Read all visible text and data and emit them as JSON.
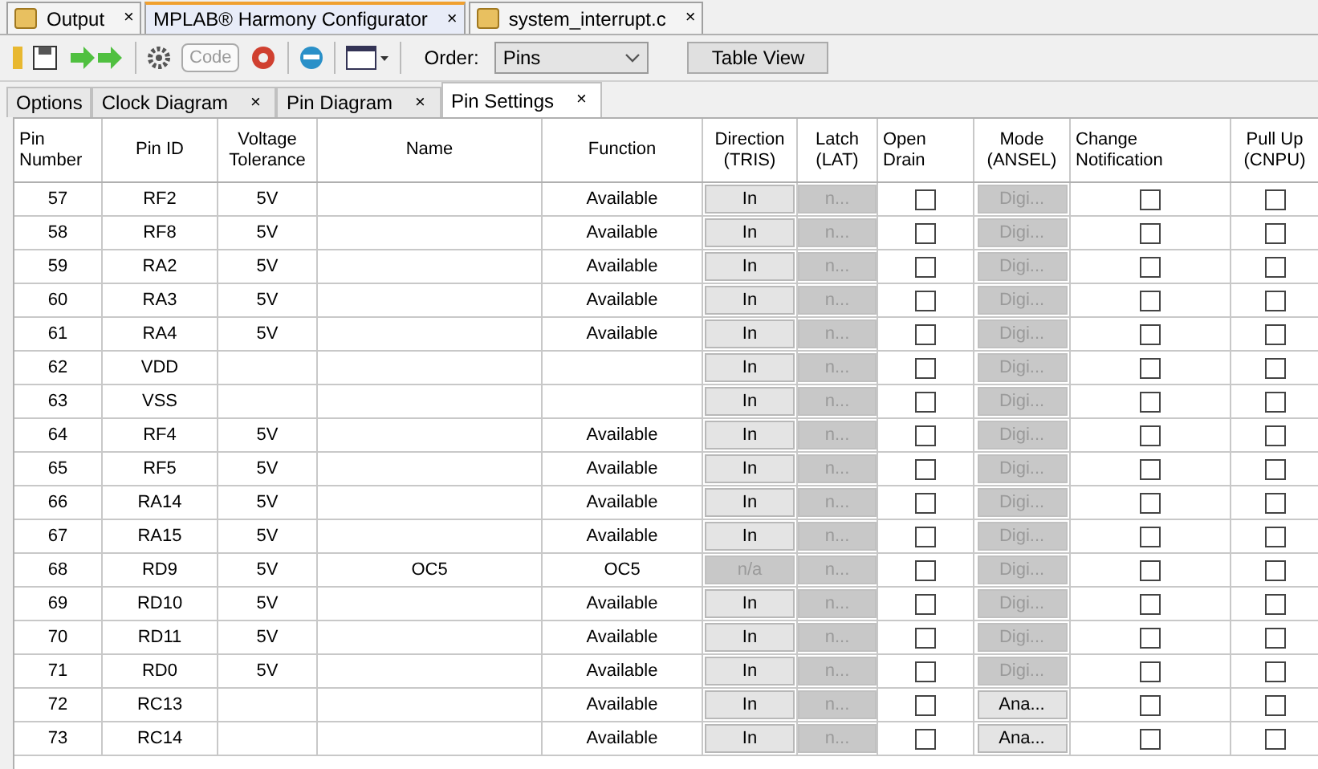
{
  "editor_tabs": [
    {
      "label": "Output",
      "close": "×",
      "selected": false
    },
    {
      "label": "MPLAB® Harmony Configurator",
      "close": "×",
      "selected": true
    },
    {
      "label": "system_interrupt.c",
      "close": "×",
      "selected": false
    }
  ],
  "toolbar": {
    "code_button": "Code",
    "order_label": "Order:",
    "order_value": "Pins",
    "table_view_button": "Table View"
  },
  "view_tabs": [
    {
      "label": "Options",
      "selected": false
    },
    {
      "label": "Clock Diagram",
      "close": "×",
      "selected": false
    },
    {
      "label": "Pin Diagram",
      "close": "×",
      "selected": false
    },
    {
      "label": "Pin Settings",
      "close": "×",
      "selected": true
    }
  ],
  "table": {
    "columns": [
      [
        "Pin",
        "Number"
      ],
      [
        "Pin ID"
      ],
      [
        "Voltage",
        "Tolerance"
      ],
      [
        "Name"
      ],
      [
        "Function"
      ],
      [
        "Direction",
        "(TRIS)"
      ],
      [
        "Latch",
        "(LAT)"
      ],
      [
        "Open",
        "Drain"
      ],
      [
        "Mode",
        "(ANSEL)"
      ],
      [
        "Change",
        "Notification"
      ],
      [
        "Pull Up",
        "(CNPU)"
      ]
    ],
    "rows": [
      {
        "pin": "57",
        "id": "RF2",
        "volt": "5V",
        "name": "",
        "func": "Available",
        "dir": "In",
        "dir_disabled": false,
        "lat": "n...",
        "od": false,
        "mode": "Digi...",
        "mode_disabled": true,
        "cn": false,
        "pu": false
      },
      {
        "pin": "58",
        "id": "RF8",
        "volt": "5V",
        "name": "",
        "func": "Available",
        "dir": "In",
        "dir_disabled": false,
        "lat": "n...",
        "od": false,
        "mode": "Digi...",
        "mode_disabled": true,
        "cn": false,
        "pu": false
      },
      {
        "pin": "59",
        "id": "RA2",
        "volt": "5V",
        "name": "",
        "func": "Available",
        "dir": "In",
        "dir_disabled": false,
        "lat": "n...",
        "od": false,
        "mode": "Digi...",
        "mode_disabled": true,
        "cn": false,
        "pu": false
      },
      {
        "pin": "60",
        "id": "RA3",
        "volt": "5V",
        "name": "",
        "func": "Available",
        "dir": "In",
        "dir_disabled": false,
        "lat": "n...",
        "od": false,
        "mode": "Digi...",
        "mode_disabled": true,
        "cn": false,
        "pu": false
      },
      {
        "pin": "61",
        "id": "RA4",
        "volt": "5V",
        "name": "",
        "func": "Available",
        "dir": "In",
        "dir_disabled": false,
        "lat": "n...",
        "od": false,
        "mode": "Digi...",
        "mode_disabled": true,
        "cn": false,
        "pu": false
      },
      {
        "pin": "62",
        "id": "VDD",
        "volt": "",
        "name": "",
        "func": "",
        "dir": "In",
        "dir_disabled": false,
        "lat": "n...",
        "od": false,
        "mode": "Digi...",
        "mode_disabled": true,
        "cn": false,
        "pu": false
      },
      {
        "pin": "63",
        "id": "VSS",
        "volt": "",
        "name": "",
        "func": "",
        "dir": "In",
        "dir_disabled": false,
        "lat": "n...",
        "od": false,
        "mode": "Digi...",
        "mode_disabled": true,
        "cn": false,
        "pu": false
      },
      {
        "pin": "64",
        "id": "RF4",
        "volt": "5V",
        "name": "",
        "func": "Available",
        "dir": "In",
        "dir_disabled": false,
        "lat": "n...",
        "od": false,
        "mode": "Digi...",
        "mode_disabled": true,
        "cn": false,
        "pu": false
      },
      {
        "pin": "65",
        "id": "RF5",
        "volt": "5V",
        "name": "",
        "func": "Available",
        "dir": "In",
        "dir_disabled": false,
        "lat": "n...",
        "od": false,
        "mode": "Digi...",
        "mode_disabled": true,
        "cn": false,
        "pu": false
      },
      {
        "pin": "66",
        "id": "RA14",
        "volt": "5V",
        "name": "",
        "func": "Available",
        "dir": "In",
        "dir_disabled": false,
        "lat": "n...",
        "od": false,
        "mode": "Digi...",
        "mode_disabled": true,
        "cn": false,
        "pu": false
      },
      {
        "pin": "67",
        "id": "RA15",
        "volt": "5V",
        "name": "",
        "func": "Available",
        "dir": "In",
        "dir_disabled": false,
        "lat": "n...",
        "od": false,
        "mode": "Digi...",
        "mode_disabled": true,
        "cn": false,
        "pu": false
      },
      {
        "pin": "68",
        "id": "RD9",
        "volt": "5V",
        "name": "OC5",
        "func": "OC5",
        "dir": "n/a",
        "dir_disabled": true,
        "lat": "n...",
        "od": false,
        "mode": "Digi...",
        "mode_disabled": true,
        "cn": false,
        "pu": false
      },
      {
        "pin": "69",
        "id": "RD10",
        "volt": "5V",
        "name": "",
        "func": "Available",
        "dir": "In",
        "dir_disabled": false,
        "lat": "n...",
        "od": false,
        "mode": "Digi...",
        "mode_disabled": true,
        "cn": false,
        "pu": false
      },
      {
        "pin": "70",
        "id": "RD11",
        "volt": "5V",
        "name": "",
        "func": "Available",
        "dir": "In",
        "dir_disabled": false,
        "lat": "n...",
        "od": false,
        "mode": "Digi...",
        "mode_disabled": true,
        "cn": false,
        "pu": false
      },
      {
        "pin": "71",
        "id": "RD0",
        "volt": "5V",
        "name": "",
        "func": "Available",
        "dir": "In",
        "dir_disabled": false,
        "lat": "n...",
        "od": false,
        "mode": "Digi...",
        "mode_disabled": true,
        "cn": false,
        "pu": false
      },
      {
        "pin": "72",
        "id": "RC13",
        "volt": "",
        "name": "",
        "func": "Available",
        "dir": "In",
        "dir_disabled": false,
        "lat": "n...",
        "od": false,
        "mode": "Ana...",
        "mode_disabled": false,
        "cn": false,
        "pu": false
      },
      {
        "pin": "73",
        "id": "RC14",
        "volt": "",
        "name": "",
        "func": "Available",
        "dir": "In",
        "dir_disabled": false,
        "lat": "n...",
        "od": false,
        "mode": "Ana...",
        "mode_disabled": false,
        "cn": false,
        "pu": false
      }
    ]
  }
}
